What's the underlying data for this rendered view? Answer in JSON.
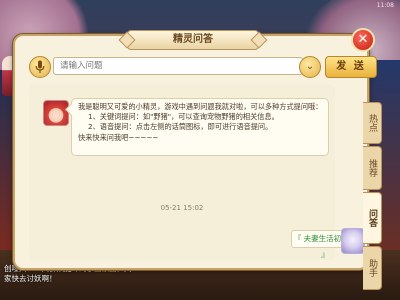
{
  "status": {
    "time": "11:08"
  },
  "dialog": {
    "title": "精灵问答",
    "close_glyph": "✕"
  },
  "search": {
    "placeholder": "请输入问题",
    "dropdown_glyph": "⌄",
    "send_label": "发 送"
  },
  "npc": {
    "greeting": "我是聪明又可爱的小精灵，游戏中遇到问题我就对啦，可以多种方式提问哦：",
    "line1": "1、关键词提问：如\"野猪\"，可以查询宠物野猪的相关信息。",
    "line2": "2、语音提问：点击左侧的话筒图标，即可进行语音提问。",
    "line3": "快来快来问我吧~~~~~"
  },
  "message_time": "05-21 15:02",
  "user_message": "『 夫妻生活初体验 』",
  "side_tabs": [
    {
      "label": "热点",
      "active": false
    },
    {
      "label": "推荐",
      "active": false
    },
    {
      "label": "问答",
      "active": true
    },
    {
      "label": "助手",
      "active": false
    }
  ],
  "chat_log": {
    "line1_a": "创嚟兴：一大群妖魔冲到了",
    "line1_b": "宝象国",
    "line1_c": "，大",
    "line2": "家快去讨妖啊！"
  },
  "colors": {
    "accent": "#e9b23b",
    "close": "#c21e10",
    "user_text": "#2f8f3a"
  }
}
